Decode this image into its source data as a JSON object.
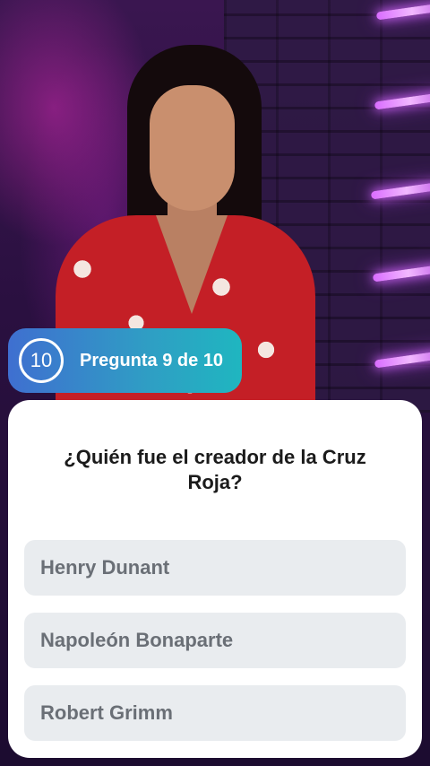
{
  "video": {
    "description_icon": "live-video-frame",
    "accent_color": "#c41f26"
  },
  "quiz": {
    "timer_value": "10",
    "counter_label": "Pregunta 9 de 10",
    "question": "¿Quién fue el creador de la Cruz Roja?",
    "options": [
      {
        "label": "Henry Dunant"
      },
      {
        "label": "Napoleón Bonaparte"
      },
      {
        "label": "Robert Grimm"
      }
    ],
    "badge_colors": [
      "#3f6fd0",
      "#1fb6c0"
    ]
  }
}
